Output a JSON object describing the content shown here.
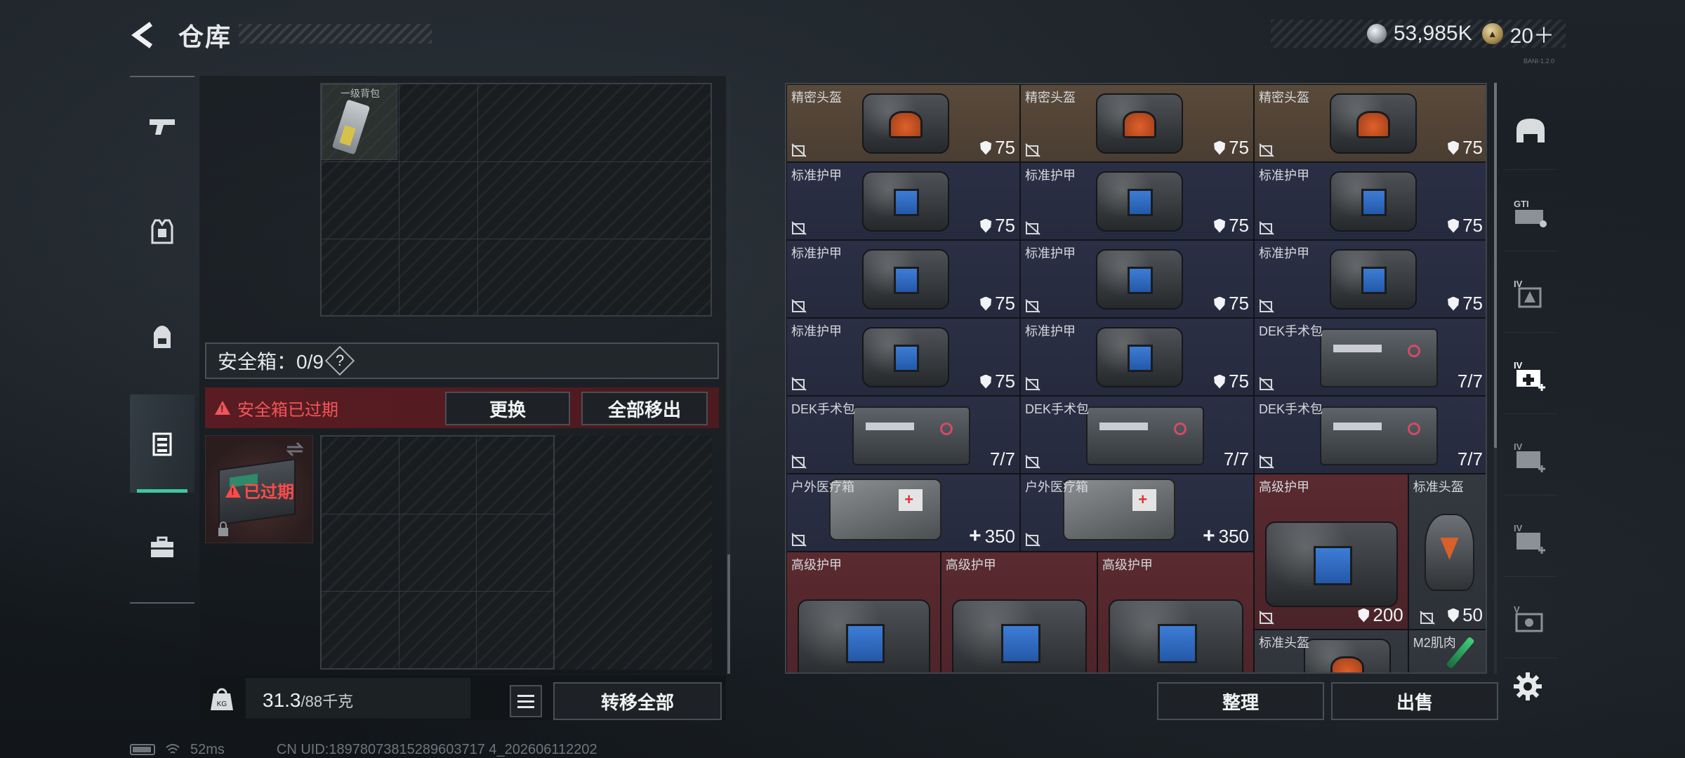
{
  "header": {
    "title": "仓库",
    "currency_silver": "53,985K",
    "currency_gold": "20＋",
    "build_text": "BANI-1.2.0"
  },
  "left_tabs": [
    {
      "name": "weapons",
      "icon": "pistol-icon"
    },
    {
      "name": "armor",
      "icon": "vest-icon"
    },
    {
      "name": "backpack",
      "icon": "backpack-icon"
    },
    {
      "name": "safebox",
      "icon": "safebox-icon",
      "active": true
    },
    {
      "name": "tools",
      "icon": "toolbox-icon"
    }
  ],
  "backpack": {
    "item_label": "一级背包"
  },
  "safebox": {
    "label": "安全箱：0/9",
    "help": "?",
    "expired_warning": "安全箱已过期",
    "replace_label": "更换",
    "move_all_label": "全部移出",
    "card_status": "已过期"
  },
  "weight": {
    "current": "31.3",
    "max": "/88千克"
  },
  "bottom_left": {
    "transfer_all_label": "转移全部"
  },
  "inventory": {
    "cells": [
      {
        "name": "精密头盔",
        "value": "75",
        "kind": "gold",
        "art": "vest-orange",
        "val_icon": "shield"
      },
      {
        "name": "精密头盔",
        "value": "75",
        "kind": "gold",
        "art": "vest-orange",
        "val_icon": "shield"
      },
      {
        "name": "精密头盔",
        "value": "75",
        "kind": "gold",
        "art": "vest-orange",
        "val_icon": "shield"
      },
      {
        "name": "标准护甲",
        "value": "75",
        "kind": "blue",
        "art": "vest-blue",
        "val_icon": "shield"
      },
      {
        "name": "标准护甲",
        "value": "75",
        "kind": "blue",
        "art": "vest-blue",
        "val_icon": "shield"
      },
      {
        "name": "标准护甲",
        "value": "75",
        "kind": "blue",
        "art": "vest-blue",
        "val_icon": "shield"
      },
      {
        "name": "标准护甲",
        "value": "75",
        "kind": "blue",
        "art": "vest-blue",
        "val_icon": "shield"
      },
      {
        "name": "标准护甲",
        "value": "75",
        "kind": "blue",
        "art": "vest-blue",
        "val_icon": "shield"
      },
      {
        "name": "标准护甲",
        "value": "75",
        "kind": "blue",
        "art": "vest-blue",
        "val_icon": "shield"
      },
      {
        "name": "标准护甲",
        "value": "75",
        "kind": "blue",
        "art": "vest-blue",
        "val_icon": "shield"
      },
      {
        "name": "标准护甲",
        "value": "75",
        "kind": "blue",
        "art": "vest-blue",
        "val_icon": "shield"
      },
      {
        "name": "DEK手术包",
        "value": "7/7",
        "kind": "blue",
        "art": "kit",
        "val_icon": "none"
      },
      {
        "name": "DEK手术包",
        "value": "7/7",
        "kind": "blue",
        "art": "kit",
        "val_icon": "none"
      },
      {
        "name": "DEK手术包",
        "value": "7/7",
        "kind": "blue",
        "art": "kit",
        "val_icon": "none"
      },
      {
        "name": "DEK手术包",
        "value": "7/7",
        "kind": "blue",
        "art": "kit",
        "val_icon": "none"
      },
      {
        "name": "户外医疗箱",
        "value": "350",
        "kind": "blue",
        "art": "medbag",
        "val_icon": "plus"
      },
      {
        "name": "户外医疗箱",
        "value": "350",
        "kind": "blue",
        "art": "medbag",
        "val_icon": "plus"
      },
      {
        "name": "高级护甲",
        "value": "200",
        "kind": "red",
        "art": "vest-blue-big",
        "val_icon": "shield"
      },
      {
        "name": "标准头盔",
        "value": "50",
        "kind": "gray",
        "art": "helmet",
        "val_icon": "shield"
      },
      {
        "name": "高级护甲",
        "value": "",
        "kind": "red",
        "art": "vest-blue-big",
        "val_icon": "none"
      },
      {
        "name": "高级护甲",
        "value": "",
        "kind": "red",
        "art": "vest-blue-big",
        "val_icon": "none"
      },
      {
        "name": "高级护甲",
        "value": "",
        "kind": "red",
        "art": "vest-blue-big",
        "val_icon": "none"
      },
      {
        "name": "标准头盔",
        "value": "",
        "kind": "gray",
        "art": "vest-orange",
        "val_icon": "none"
      },
      {
        "name": "M2肌肉",
        "value": "",
        "kind": "gray",
        "art": "syringe",
        "val_icon": "none"
      }
    ]
  },
  "bottom_right": {
    "sort_label": "整理",
    "sell_label": "出售"
  },
  "right_tabs": [
    {
      "name": "helmet",
      "icon": "helmet-tab-icon",
      "badge": ""
    },
    {
      "name": "gti",
      "icon": "gti-icon",
      "badge": "GTI"
    },
    {
      "name": "armor-4",
      "icon": "armor-iv-icon",
      "badge": "IV"
    },
    {
      "name": "med-4",
      "icon": "med-iv-icon",
      "badge": "IV"
    },
    {
      "name": "med-4b",
      "icon": "med-iv-icon",
      "badge": "IV"
    },
    {
      "name": "med-4c",
      "icon": "med-iv-icon",
      "badge": "IV"
    },
    {
      "name": "ammo-5",
      "icon": "ammo-v-icon",
      "badge": "V"
    }
  ],
  "status_bar": {
    "ping": "52ms",
    "uid": "CN UID:18978073815289603717 4_202606112202"
  }
}
